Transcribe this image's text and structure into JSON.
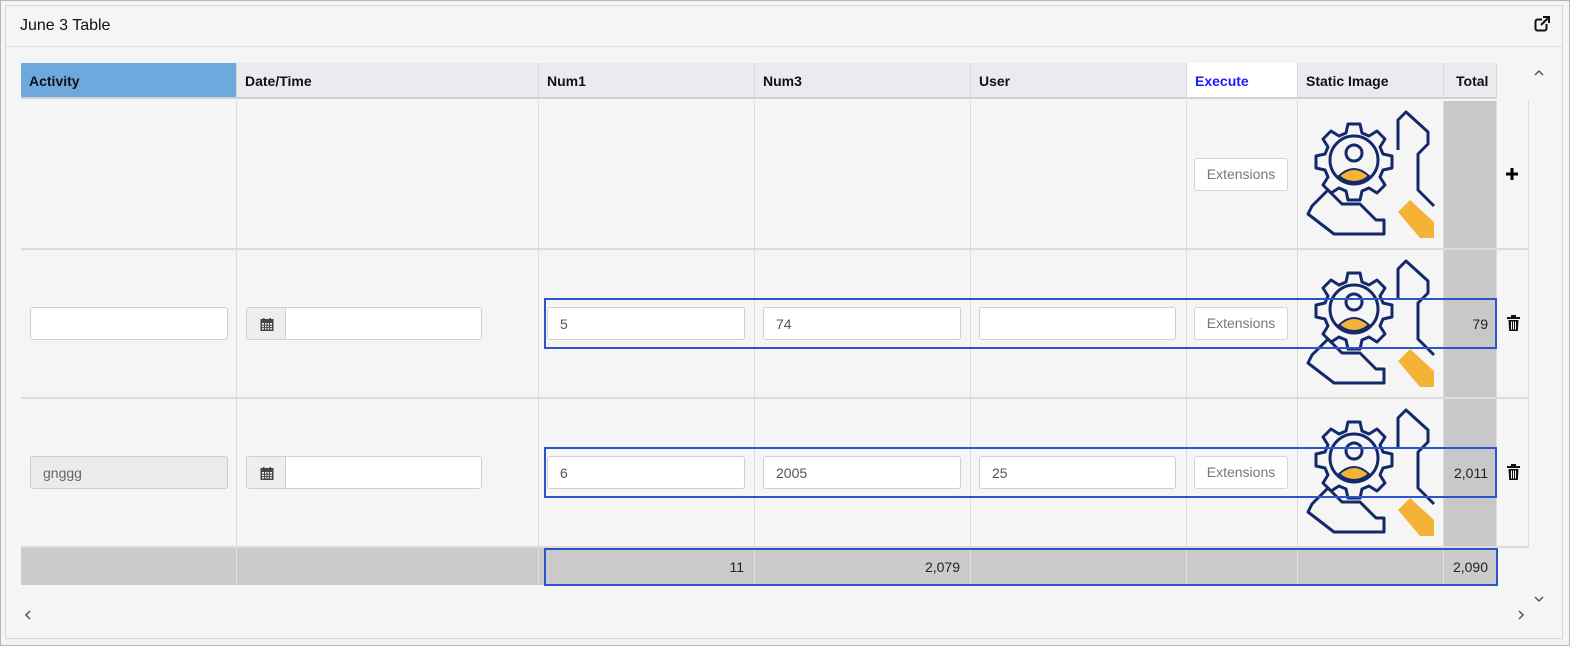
{
  "panel": {
    "title": "June 3 Table"
  },
  "table": {
    "headers": {
      "activity": "Activity",
      "datetime": "Date/Time",
      "num1": "Num1",
      "num3": "Num3",
      "user": "User",
      "execute": "Execute",
      "static_image": "Static Image",
      "total": "Total"
    },
    "rows": [
      {
        "activity": "",
        "datetime": "",
        "num1": "",
        "num3": "",
        "user": "",
        "execute": "Extensions",
        "total": ""
      },
      {
        "activity": "",
        "datetime": "",
        "num1": "5",
        "num3": "74",
        "user": "",
        "execute": "Extensions",
        "total": "79"
      },
      {
        "activity": "gnggg",
        "datetime": "",
        "num1": "6",
        "num3": "2005",
        "user": "25",
        "execute": "Extensions",
        "total": "2,011"
      }
    ],
    "footer": {
      "num1": "11",
      "num3": "2,079",
      "total": "2,090"
    }
  },
  "colors": {
    "active_header": "#6fa8dc",
    "execute_link": "#1a1aff",
    "selection": "#2b55c9",
    "icon_navy": "#14296b",
    "icon_orange": "#f5b335"
  },
  "icons": [
    "external-link-icon",
    "calendar-icon",
    "plus-icon",
    "trash-icon",
    "gear-user-wrench-image"
  ]
}
